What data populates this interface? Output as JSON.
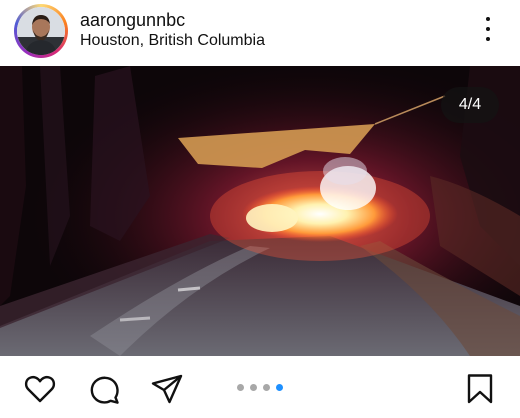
{
  "post": {
    "username": "aarongunnbc",
    "location": "Houston, British Columbia",
    "media_counter": "4/4",
    "carousel": {
      "total": 4,
      "active_index": 3
    }
  },
  "icons": {
    "more": "more-vertical-icon",
    "like": "heart-icon",
    "comment": "comment-bubble-icon",
    "share": "paper-plane-icon",
    "save": "bookmark-icon"
  },
  "colors": {
    "active_dot": "#1e90ff",
    "inactive_dot": "#a8a8a8"
  }
}
